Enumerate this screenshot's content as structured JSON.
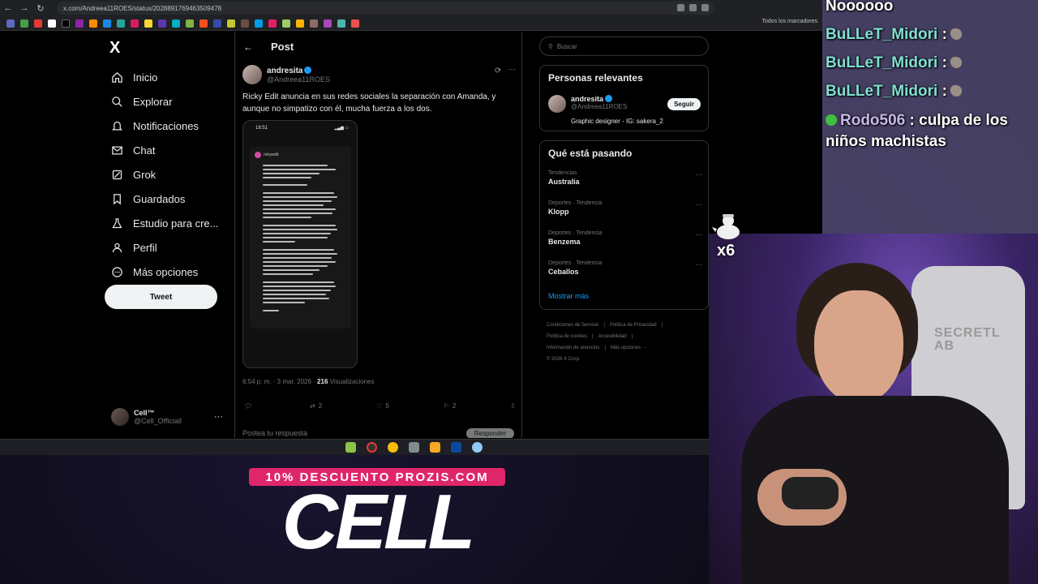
{
  "browser": {
    "url": "x.com/Andreea11ROES/status/2028891769463509478",
    "bookmarks_folder": "Todos los marcadores"
  },
  "sidebar": {
    "logo": "X",
    "items": [
      {
        "label": "Inicio",
        "icon": "home-icon"
      },
      {
        "label": "Explorar",
        "icon": "search-icon"
      },
      {
        "label": "Notificaciones",
        "icon": "bell-icon"
      },
      {
        "label": "Chat",
        "icon": "mail-icon"
      },
      {
        "label": "Grok",
        "icon": "grok-icon"
      },
      {
        "label": "Guardados",
        "icon": "bookmark-icon"
      },
      {
        "label": "Estudio para cre...",
        "icon": "studio-icon"
      },
      {
        "label": "Perfil",
        "icon": "person-icon"
      },
      {
        "label": "Más opciones",
        "icon": "more-circle-icon"
      }
    ],
    "tweet_button": "Tweet",
    "account": {
      "name": "Cell™",
      "handle": "@Cell_Officiall"
    }
  },
  "post": {
    "header": "Post",
    "author": {
      "name": "andresita",
      "handle": "@Andreea11ROES"
    },
    "text": "Ricky Edit anuncia en sus redes sociales la separación con Amanda, y aunque no simpatizo con él, mucha fuerza a los dos.",
    "media": {
      "phone_time": "18:51",
      "story_user": "rickyedit"
    },
    "time": "6:54 p. m. · 3 mar. 2026 · ",
    "views_count": "216",
    "views_label": " Visualizaciones",
    "actions": {
      "replies": "",
      "reposts": "2",
      "likes": "5",
      "bookmarks": "2"
    },
    "reply_placeholder": "Postea tu respuesta",
    "reply_button": "Responder"
  },
  "right": {
    "search_placeholder": "Buscar",
    "relevant_title": "Personas relevantes",
    "relevant_user": {
      "name": "andresita",
      "handle": "@Andreea11ROES",
      "bio": "Graphic designer - IG: sakera_2",
      "follow": "Seguir"
    },
    "trends_title": "Qué está pasando",
    "trends": [
      {
        "category": "Tendencias",
        "name": "Australia"
      },
      {
        "category": "Deportes · Tendencia",
        "name": "Klopp"
      },
      {
        "category": "Deportes · Tendencia",
        "name": "Benzema"
      },
      {
        "category": "Deportes · Tendencia",
        "name": "Ceballos"
      }
    ],
    "show_more": "Mostrar más",
    "footer": [
      "Condiciones de Servicio",
      "|",
      "Política de Privacidad",
      "|",
      "Política de cookies",
      "|",
      "Accesibilidad",
      "|",
      "Información de anuncios",
      "|",
      "Más opciones ···",
      "© 2026 X Corp."
    ]
  },
  "chat": [
    {
      "text": "Noooooo"
    },
    {
      "user": "BuLLeT_Midori",
      "message": ":"
    },
    {
      "user": "BuLLeT_Midori",
      "message": ":"
    },
    {
      "user": "BuLLeT_Midori",
      "message": ":"
    },
    {
      "user": "Rodo506",
      "message": ": culpa de los niños machistas"
    }
  ],
  "gift": {
    "multiplier": "x6"
  },
  "webcam": {
    "chair_brand": "SECRETLAB"
  },
  "promo": {
    "banner": "10% DESCUENTO PROZIS.COM",
    "big": "CELL"
  },
  "colors": {
    "accent": "#1d9bf0",
    "promo": "#e0266a",
    "chat_user": "#7fe0d0"
  }
}
